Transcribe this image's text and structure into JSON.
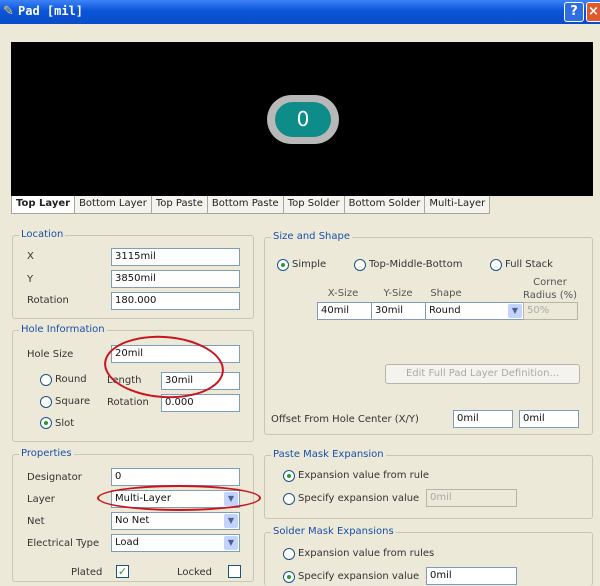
{
  "window": {
    "title": "Pad [mil]",
    "help_glyph": "?",
    "close_glyph": "×",
    "icon": "pad-tool-icon"
  },
  "preview": {
    "pad_label": "0"
  },
  "tabs": [
    "Top Layer",
    "Bottom Layer",
    "Top Paste",
    "Bottom Paste",
    "Top Solder",
    "Bottom Solder",
    "Multi-Layer"
  ],
  "location": {
    "title": "Location",
    "x_label": "X",
    "x_value": "3115mil",
    "y_label": "Y",
    "y_value": "3850mil",
    "rotation_label": "Rotation",
    "rotation_value": "180.000"
  },
  "hole": {
    "title": "Hole Information",
    "size_label": "Hole Size",
    "size_value": "20mil",
    "round_label": "Round",
    "square_label": "Square",
    "slot_label": "Slot",
    "length_label": "Length",
    "length_value": "30mil",
    "rotation_label": "Rotation",
    "rotation_value": "0.000",
    "selected": "Slot"
  },
  "properties": {
    "title": "Properties",
    "designator_label": "Designator",
    "designator_value": "0",
    "layer_label": "Layer",
    "layer_value": "Multi-Layer",
    "net_label": "Net",
    "net_value": "No Net",
    "electrical_label": "Electrical Type",
    "electrical_value": "Load",
    "plated_label": "Plated",
    "plated_checked": true,
    "locked_label": "Locked",
    "locked_checked": false
  },
  "size_shape": {
    "title": "Size and Shape",
    "simple_label": "Simple",
    "tmb_label": "Top-Middle-Bottom",
    "full_stack_label": "Full Stack",
    "selected": "Simple",
    "col_xsize": "X-Size",
    "col_ysize": "Y-Size",
    "col_shape": "Shape",
    "col_radius": "Corner\nRadius (%)",
    "xsize": "40mil",
    "ysize": "30mil",
    "shape": "Round",
    "radius": "50%",
    "edit_button": "Edit Full Pad Layer Definition...",
    "offset_label": "Offset From Hole Center (X/Y)",
    "offset_x": "0mil",
    "offset_y": "0mil"
  },
  "paste_mask": {
    "title": "Paste Mask Expansion",
    "rule_label": "Expansion value from rule",
    "specify_label": "Specify expansion value",
    "specify_value": "0mil",
    "selected": "rule"
  },
  "solder_mask": {
    "title": "Solder Mask Expansions",
    "rule_label": "Expansion value from rules",
    "specify_label": "Specify expansion value",
    "specify_value": "0mil",
    "selected": "specify"
  },
  "colors": {
    "annotation": "#c8151d",
    "pad_fill": "#0e8c8a",
    "pad_ring": "#b8b8b8"
  }
}
